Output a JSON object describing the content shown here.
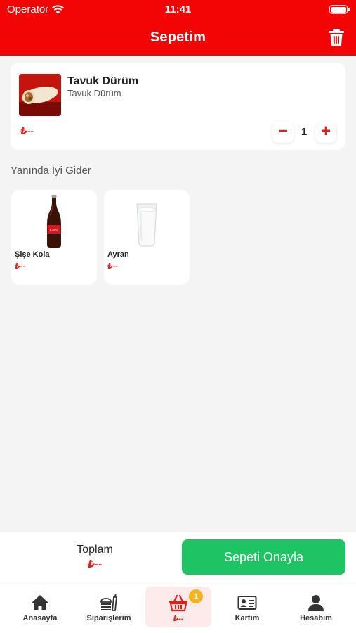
{
  "status_bar": {
    "carrier": "Operatör",
    "time": "11:41"
  },
  "header": {
    "title": "Sepetim",
    "trash_icon": "trash-icon"
  },
  "cart_item": {
    "name": "Tavuk Dürüm",
    "description": "Tavuk Dürüm",
    "price": "₺--",
    "quantity": "1",
    "minus_label": "−",
    "plus_label": "+"
  },
  "suggestions": {
    "title": "Yanında İyi Gider",
    "items": [
      {
        "name": "Şişe Kola",
        "price": "₺--"
      },
      {
        "name": "Ayran",
        "price": "₺--"
      }
    ]
  },
  "summary": {
    "total_label": "Toplam",
    "total_value": "₺--",
    "confirm_label": "Sepeti Onayla"
  },
  "tabs": [
    {
      "label": "Anasayfa",
      "icon": "home-icon"
    },
    {
      "label": "Siparişlerim",
      "icon": "orders-icon"
    },
    {
      "label": "₺--",
      "icon": "basket-icon",
      "badge": "1",
      "active": true
    },
    {
      "label": "Kartım",
      "icon": "id-card-icon"
    },
    {
      "label": "Hesabım",
      "icon": "user-icon"
    }
  ],
  "colors": {
    "brand": "#f30405",
    "accent": "#e2211c",
    "confirm": "#1ec463",
    "badge": "#f5b120"
  }
}
